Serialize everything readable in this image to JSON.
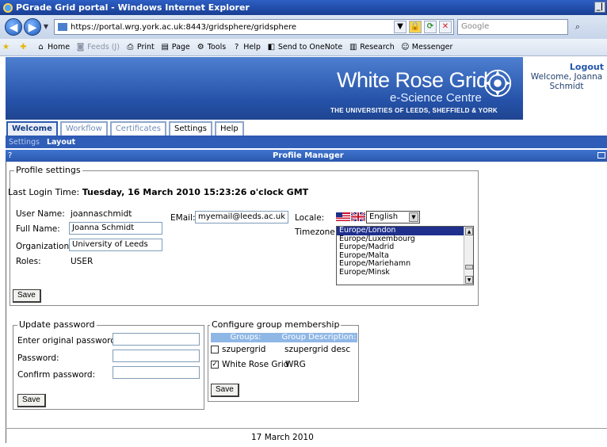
{
  "window": {
    "title": "PGrade Grid portal - Windows Internet Explorer",
    "min_button": "_|"
  },
  "address_bar": {
    "url": "https://portal.wrg.york.ac.uk:8443/gridsphere/gridsphere",
    "search_placeholder": "Google"
  },
  "ie_toolbar": {
    "items": [
      "Home",
      "Feeds (J)",
      "Print",
      "Page",
      "Tools",
      "Help",
      "Send to OneNote",
      "Research",
      "Messenger"
    ]
  },
  "banner": {
    "brand_title": "White Rose Grid",
    "brand_subtitle": "e-Science Centre",
    "brand_tagline": "THE UNIVERSITIES OF LEEDS, SHEFFIELD & YORK",
    "logout_label": "Logout",
    "welcome_text": "Welcome, Joanna Schmidt"
  },
  "tabs": [
    {
      "label": "Welcome",
      "state": "active"
    },
    {
      "label": "Workflow",
      "state": "dim"
    },
    {
      "label": "Certificates",
      "state": "dim"
    },
    {
      "label": "Settings",
      "state": "plain"
    },
    {
      "label": "Help",
      "state": "plain"
    }
  ],
  "subtabs": [
    {
      "label": "Settings",
      "active": false
    },
    {
      "label": "Layout",
      "active": true
    }
  ],
  "portlet": {
    "help_glyph": "?",
    "title": "Profile Manager"
  },
  "profile": {
    "legend": "Profile settings",
    "last_login_label": "Last Login Time:",
    "last_login_value": "Tuesday, 16 March 2010 15:23:26 o'clock GMT",
    "username_label": "User Name:",
    "username_value": "joannaschmidt",
    "fullname_label": "Full Name:",
    "fullname_value": "Joanna Schmidt",
    "organization_label": "Organization:",
    "organization_value": "University of Leeds",
    "roles_label": "Roles:",
    "roles_value": "USER",
    "email_label": "EMail:",
    "email_value": "myemail@leeds.ac.uk",
    "locale_label": "Locale:",
    "locale_value": "English",
    "timezone_label": "Timezone:",
    "timezone_options": [
      "Europe/London",
      "Europe/Luxembourg",
      "Europe/Madrid",
      "Europe/Malta",
      "Europe/Mariehamn",
      "Europe/Minsk"
    ],
    "timezone_selected": "Europe/London",
    "save_label": "Save"
  },
  "password": {
    "legend": "Update password",
    "original_label": "Enter original password:",
    "password_label": "Password:",
    "confirm_label": "Confirm password:",
    "save_label": "Save"
  },
  "groups": {
    "legend": "Configure group membership",
    "col_groups": "Groups:",
    "col_description": "Group Description:",
    "rows": [
      {
        "name": "szupergrid",
        "description": "szupergrid desc",
        "checked": false
      },
      {
        "name": "White Rose Grid",
        "description": "WRG",
        "checked": true
      }
    ],
    "save_label": "Save"
  },
  "footer": {
    "date": "17 March 2010"
  }
}
